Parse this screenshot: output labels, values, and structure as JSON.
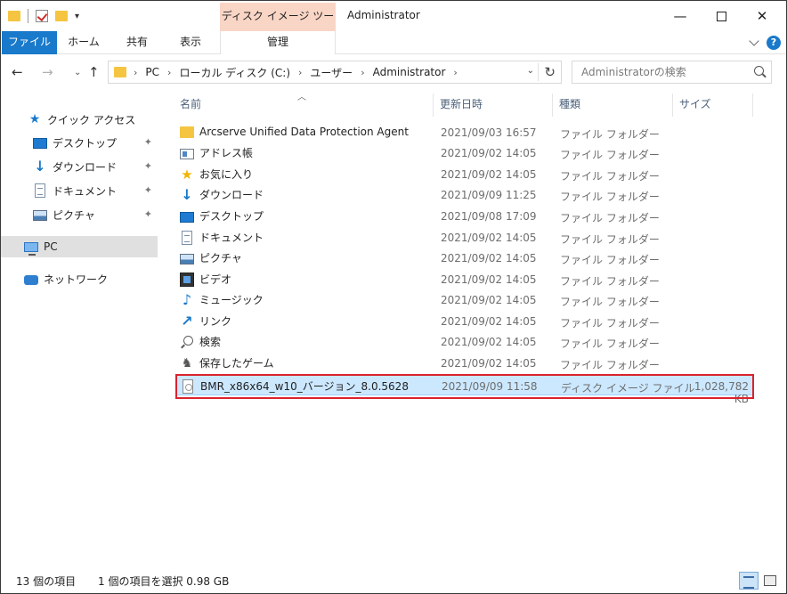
{
  "titlebar": {
    "contextual_tab": "ディスク イメージ ツール",
    "title": "Administrator",
    "minimize": "—",
    "close": "✕"
  },
  "ribbon": {
    "tabs": {
      "file": "ファイル",
      "home": "ホーム",
      "share": "共有",
      "view": "表示",
      "manage": "管理"
    },
    "help": "?"
  },
  "address": {
    "breadcrumbs": [
      "PC",
      "ローカル ディスク (C:)",
      "ユーザー",
      "Administrator"
    ],
    "search_placeholder": "Administratorの検索"
  },
  "nav": {
    "quick_access": "クイック アクセス",
    "desktop": "デスクトップ",
    "downloads": "ダウンロード",
    "documents": "ドキュメント",
    "pictures": "ピクチャ",
    "pc": "PC",
    "network": "ネットワーク"
  },
  "columns": {
    "name": "名前",
    "date": "更新日時",
    "type": "種類",
    "size": "サイズ"
  },
  "files": [
    {
      "name": "Arcserve Unified Data Protection Agent",
      "date": "2021/09/03 16:57",
      "type": "ファイル フォルダー",
      "size": "",
      "icon": "folder-icon"
    },
    {
      "name": "アドレス帳",
      "date": "2021/09/02 14:05",
      "type": "ファイル フォルダー",
      "size": "",
      "icon": "contacts-icon"
    },
    {
      "name": "お気に入り",
      "date": "2021/09/02 14:05",
      "type": "ファイル フォルダー",
      "size": "",
      "icon": "favorites-star-icon"
    },
    {
      "name": "ダウンロード",
      "date": "2021/09/09 11:25",
      "type": "ファイル フォルダー",
      "size": "",
      "icon": "download-arrow-icon"
    },
    {
      "name": "デスクトップ",
      "date": "2021/09/08 17:09",
      "type": "ファイル フォルダー",
      "size": "",
      "icon": "desktop-icon"
    },
    {
      "name": "ドキュメント",
      "date": "2021/09/02 14:05",
      "type": "ファイル フォルダー",
      "size": "",
      "icon": "document-icon"
    },
    {
      "name": "ピクチャ",
      "date": "2021/09/02 14:05",
      "type": "ファイル フォルダー",
      "size": "",
      "icon": "picture-icon"
    },
    {
      "name": "ビデオ",
      "date": "2021/09/02 14:05",
      "type": "ファイル フォルダー",
      "size": "",
      "icon": "video-icon"
    },
    {
      "name": "ミュージック",
      "date": "2021/09/02 14:05",
      "type": "ファイル フォルダー",
      "size": "",
      "icon": "music-note-icon"
    },
    {
      "name": "リンク",
      "date": "2021/09/02 14:05",
      "type": "ファイル フォルダー",
      "size": "",
      "icon": "link-arrow-icon"
    },
    {
      "name": "検索",
      "date": "2021/09/02 14:05",
      "type": "ファイル フォルダー",
      "size": "",
      "icon": "search-icon"
    },
    {
      "name": "保存したゲーム",
      "date": "2021/09/02 14:05",
      "type": "ファイル フォルダー",
      "size": "",
      "icon": "game-icon"
    },
    {
      "name": "BMR_x86x64_w10_バージョン_8.0.5628",
      "date": "2021/09/09 11:58",
      "type": "ディスク イメージ ファイル",
      "size": "1,028,782 KB",
      "icon": "disc-image-icon"
    }
  ],
  "status": {
    "count": "13 個の項目",
    "selected": "1 個の項目を選択  0.98 GB"
  },
  "colors": {
    "accent": "#1979ca",
    "contextual_tab": "#f9d5c5",
    "selection": "#cce8ff",
    "highlight_border": "#d9232e"
  }
}
